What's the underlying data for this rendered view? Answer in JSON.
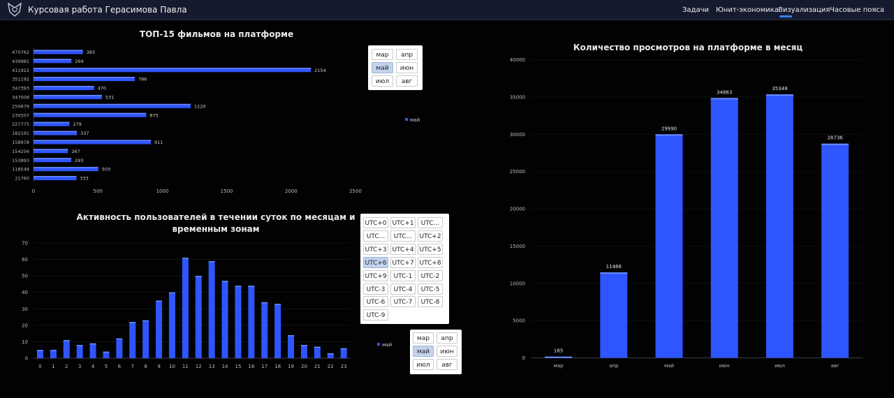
{
  "header": {
    "title": "Курсовая работа Герасимова Павла",
    "nav": [
      "Задачи",
      "Юнит-экономика",
      "Визуализация",
      "Часовые пояса"
    ],
    "active_nav": "Визуализация"
  },
  "colors": {
    "bar": "#2f55ff",
    "bar_top": "#6b8cff",
    "header_bg": "#161a2e",
    "accent": "#3d7dff"
  },
  "slicers": {
    "top_months": [
      "мар",
      "апр",
      "май",
      "июн",
      "июл",
      "авг"
    ],
    "top_months_selected": "май",
    "timezones": [
      "UTC+0",
      "UTC+1",
      "UTC...",
      "UTC...",
      "UTC...",
      "UTC+2",
      "UTC+3",
      "UTC+4",
      "UTC+5",
      "UTC+6",
      "UTC+7",
      "UTC+8",
      "UTC+9",
      "UTC-1",
      "UTC-2",
      "UTC-3",
      "UTC-4",
      "UTC-5",
      "UTC-6",
      "UTC-7",
      "UTC-8",
      "UTC-9"
    ],
    "timezones_selected": "UTC+6",
    "bottom_months": [
      "мар",
      "апр",
      "май",
      "июн",
      "июл",
      "авг"
    ],
    "bottom_months_selected": "май"
  },
  "chart_data": [
    {
      "type": "bar",
      "orientation": "horizontal",
      "title": "ТОП-15 фильмов на платформе",
      "categories": [
        "470762",
        "439981",
        "411922",
        "351192",
        "347393",
        "347008",
        "250679",
        "230507",
        "227775",
        "182191",
        "158978",
        "154256",
        "153893",
        "118549",
        "21760"
      ],
      "values": [
        383,
        294,
        2154,
        786,
        470,
        531,
        1220,
        875,
        279,
        337,
        911,
        267,
        293,
        503,
        333
      ],
      "xlim": [
        0,
        2500
      ],
      "xticks": [
        0,
        500,
        1000,
        1500,
        2000,
        2500
      ],
      "legend": "май",
      "legend_position": "right"
    },
    {
      "type": "bar",
      "title": "Активность пользователей в течении суток по месяцам и временным зонам",
      "categories": [
        "0",
        "1",
        "2",
        "3",
        "4",
        "5",
        "6",
        "7",
        "8",
        "9",
        "10",
        "11",
        "12",
        "13",
        "14",
        "15",
        "16",
        "17",
        "18",
        "19",
        "20",
        "21",
        "22",
        "23"
      ],
      "values": [
        5,
        5,
        11,
        8,
        9,
        4,
        12,
        22,
        23,
        35,
        40,
        61,
        50,
        59,
        47,
        44,
        44,
        34,
        33,
        14,
        8,
        7,
        3,
        6
      ],
      "ylim": [
        0,
        70
      ],
      "yticks": [
        0,
        10,
        20,
        30,
        40,
        50,
        60,
        70
      ],
      "legend": "май",
      "legend_position": "right"
    },
    {
      "type": "bar",
      "title": "Количество просмотров на платформе в месяц",
      "categories": [
        "мар",
        "апр",
        "май",
        "июн",
        "июл",
        "авг"
      ],
      "values": [
        165,
        11466,
        29990,
        34863,
        35348,
        28736
      ],
      "ylim": [
        0,
        40000
      ],
      "yticks": [
        0,
        5000,
        10000,
        15000,
        20000,
        25000,
        30000,
        35000,
        40000
      ]
    }
  ]
}
